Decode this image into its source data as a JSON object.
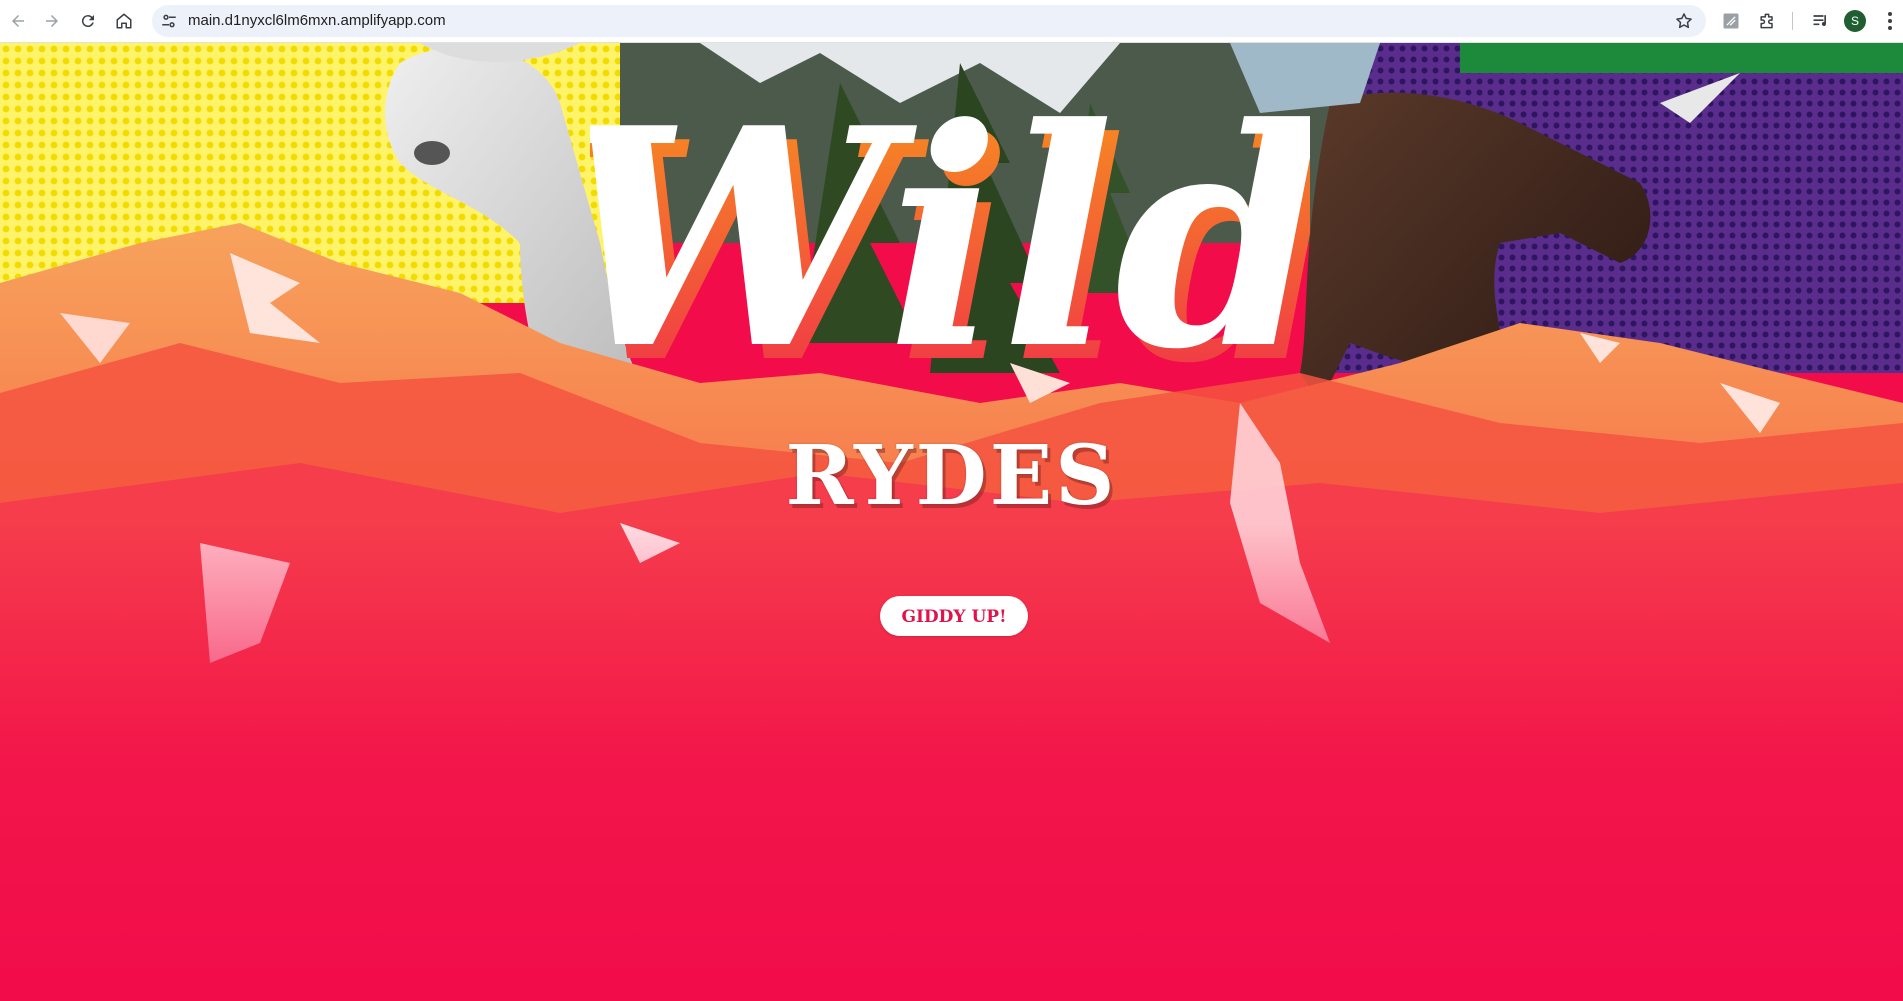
{
  "browser": {
    "url": "main.d1nyxcl6lm6mxn.amplifyapp.com",
    "profile_initial": "S",
    "icons": {
      "back": "arrow-left-icon",
      "forward": "arrow-right-icon",
      "reload": "reload-icon",
      "home": "home-icon",
      "site_info": "tune-icon",
      "bookmark": "star-icon",
      "extension_1": "puzzle-alt-icon",
      "extensions": "puzzle-icon",
      "media": "media-queue-icon",
      "menu": "kebab-menu-icon"
    }
  },
  "hero": {
    "logo_script": "Wild",
    "logo_word": "RYDES",
    "cta_label": "GIDDY UP!"
  },
  "colors": {
    "brand_pink": "#f20c4a",
    "logo_orange": "#f7941d",
    "cta_text": "#e0144c",
    "halftone_yellow": "#ffe81a",
    "halftone_purple": "#5a2d8c"
  }
}
